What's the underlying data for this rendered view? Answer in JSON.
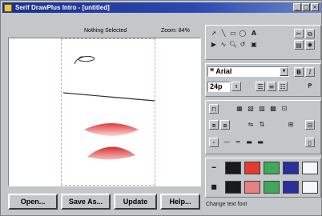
{
  "window": {
    "title": "Serif DrawPlus Intro - [untitled]",
    "controls": [
      "_",
      "□",
      "×"
    ]
  },
  "status": {
    "selection": "Nothing Selected",
    "zoom": "Zoom: 84%"
  },
  "buttons": {
    "open": "Open...",
    "save_as": "Save As...",
    "update": "Update",
    "help": "Help..."
  },
  "toolbox": {
    "text_tool": "A",
    "font_name": "Arial",
    "font_dropdown": "▾",
    "font_size": "24p",
    "bold": "B",
    "italic": "I"
  },
  "palette": {
    "line_colors": [
      "#1a1a1a",
      "#e53a2e",
      "#3fa85c",
      "#2a2f9c",
      "#f6f6f6"
    ],
    "fill_colors": [
      "#1a1a1a",
      "#e88080",
      "#3fa85c",
      "#2a2f9c",
      "#f6f6f6"
    ],
    "accent": "#2a48b0",
    "shape_fill": "#e04848"
  },
  "statusbar": {
    "message": "Change text font"
  }
}
